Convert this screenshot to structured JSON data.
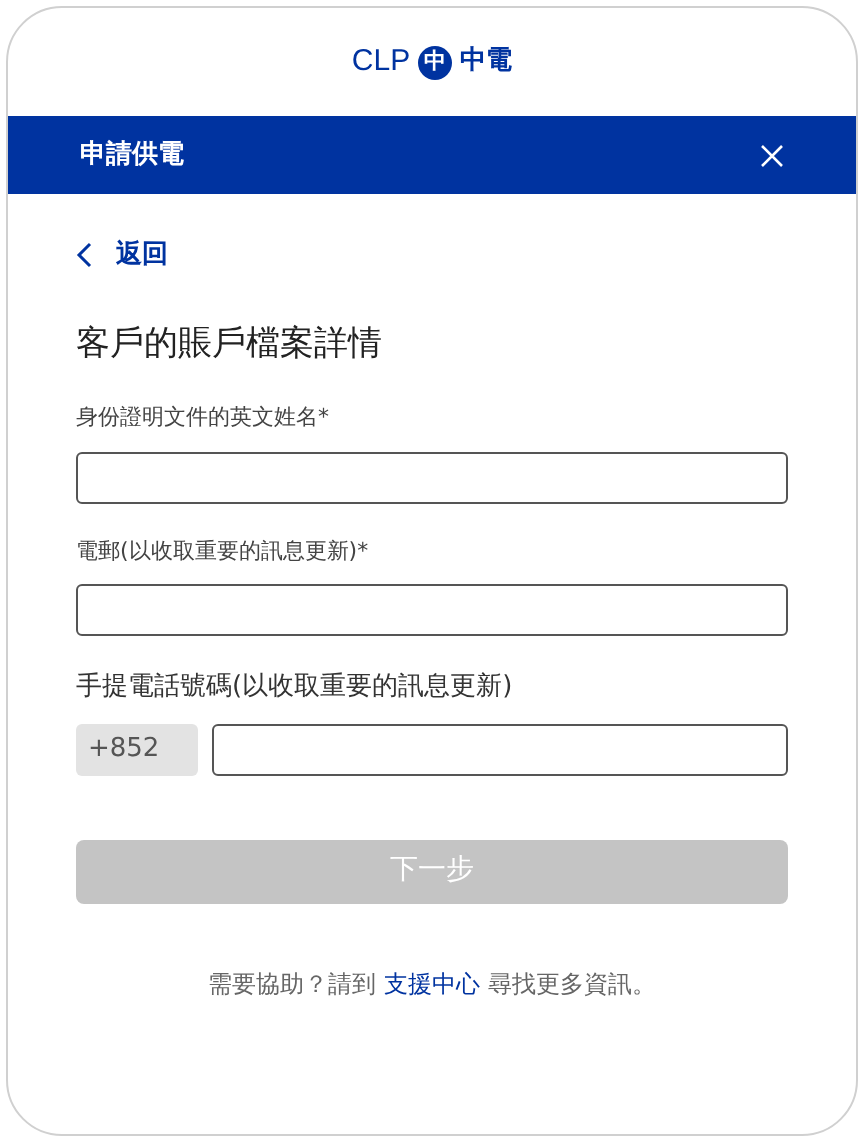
{
  "logo": {
    "brand": "CLP",
    "mark": "中",
    "name": "中電"
  },
  "header": {
    "title": "申請供電"
  },
  "back": {
    "label": "返回"
  },
  "heading": "客戶的賬戶檔案詳情",
  "fields": [
    {
      "kind": "text",
      "label": "身份證明文件的英文姓名*"
    },
    {
      "kind": "text",
      "label": "電郵(以收取重要的訊息更新)*"
    },
    {
      "kind": "phone",
      "label": "手提電話號碼(以收取重要的訊息更新)",
      "prefix": "+852"
    }
  ],
  "next_button": {
    "label": "下一步",
    "disabled": true
  },
  "help": {
    "before": "需要協助？請到 ",
    "link": "支援中心",
    "after": " 尋找更多資訊。"
  }
}
